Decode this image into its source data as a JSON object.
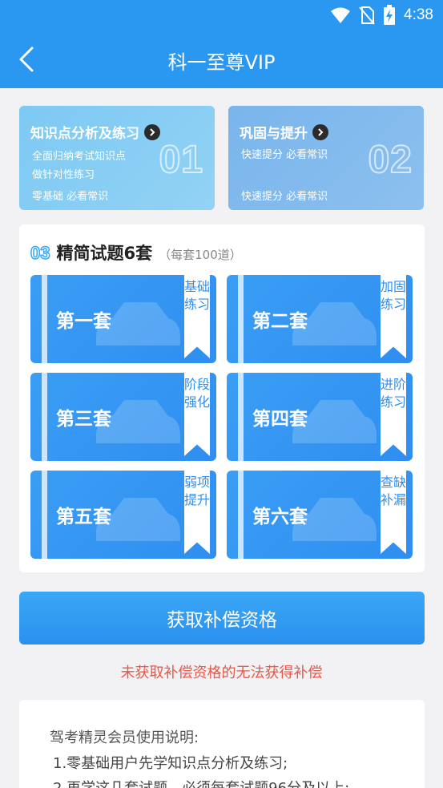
{
  "status_bar": {
    "time": "4:38"
  },
  "nav": {
    "title": "科一至尊VIP"
  },
  "top_cards": [
    {
      "title": "知识点分析及练习",
      "line1": "全面归纳考试知识点",
      "line2": "做针对性练习",
      "tag": "零基础 必看常识",
      "number": "01"
    },
    {
      "title": "巩固与提升",
      "line1": "快速提分 必看常识",
      "tag": "快速提分 必看常识",
      "number": "02"
    }
  ],
  "section": {
    "number": "03",
    "title": "精简试题6套",
    "subtitle": "（每套100道）"
  },
  "sets": [
    {
      "name": "第一套",
      "ribbon": "基础练习"
    },
    {
      "name": "第二套",
      "ribbon": "加固练习"
    },
    {
      "name": "第三套",
      "ribbon": "阶段强化"
    },
    {
      "name": "第四套",
      "ribbon": "进阶练习"
    },
    {
      "name": "第五套",
      "ribbon": "弱项提升"
    },
    {
      "name": "第六套",
      "ribbon": "查缺补漏"
    }
  ],
  "action": {
    "button": "获取补偿资格",
    "warning": "未获取补偿资格的无法获得补偿"
  },
  "notes": {
    "title": "驾考精灵会员使用说明:",
    "items": [
      "1.零基础用户先学知识点分析及练习;",
      "2.再学这几套试题，必须每套试题96分及以上;"
    ]
  },
  "colors": {
    "brand": "#2a97f0",
    "warning": "#e5584a"
  }
}
